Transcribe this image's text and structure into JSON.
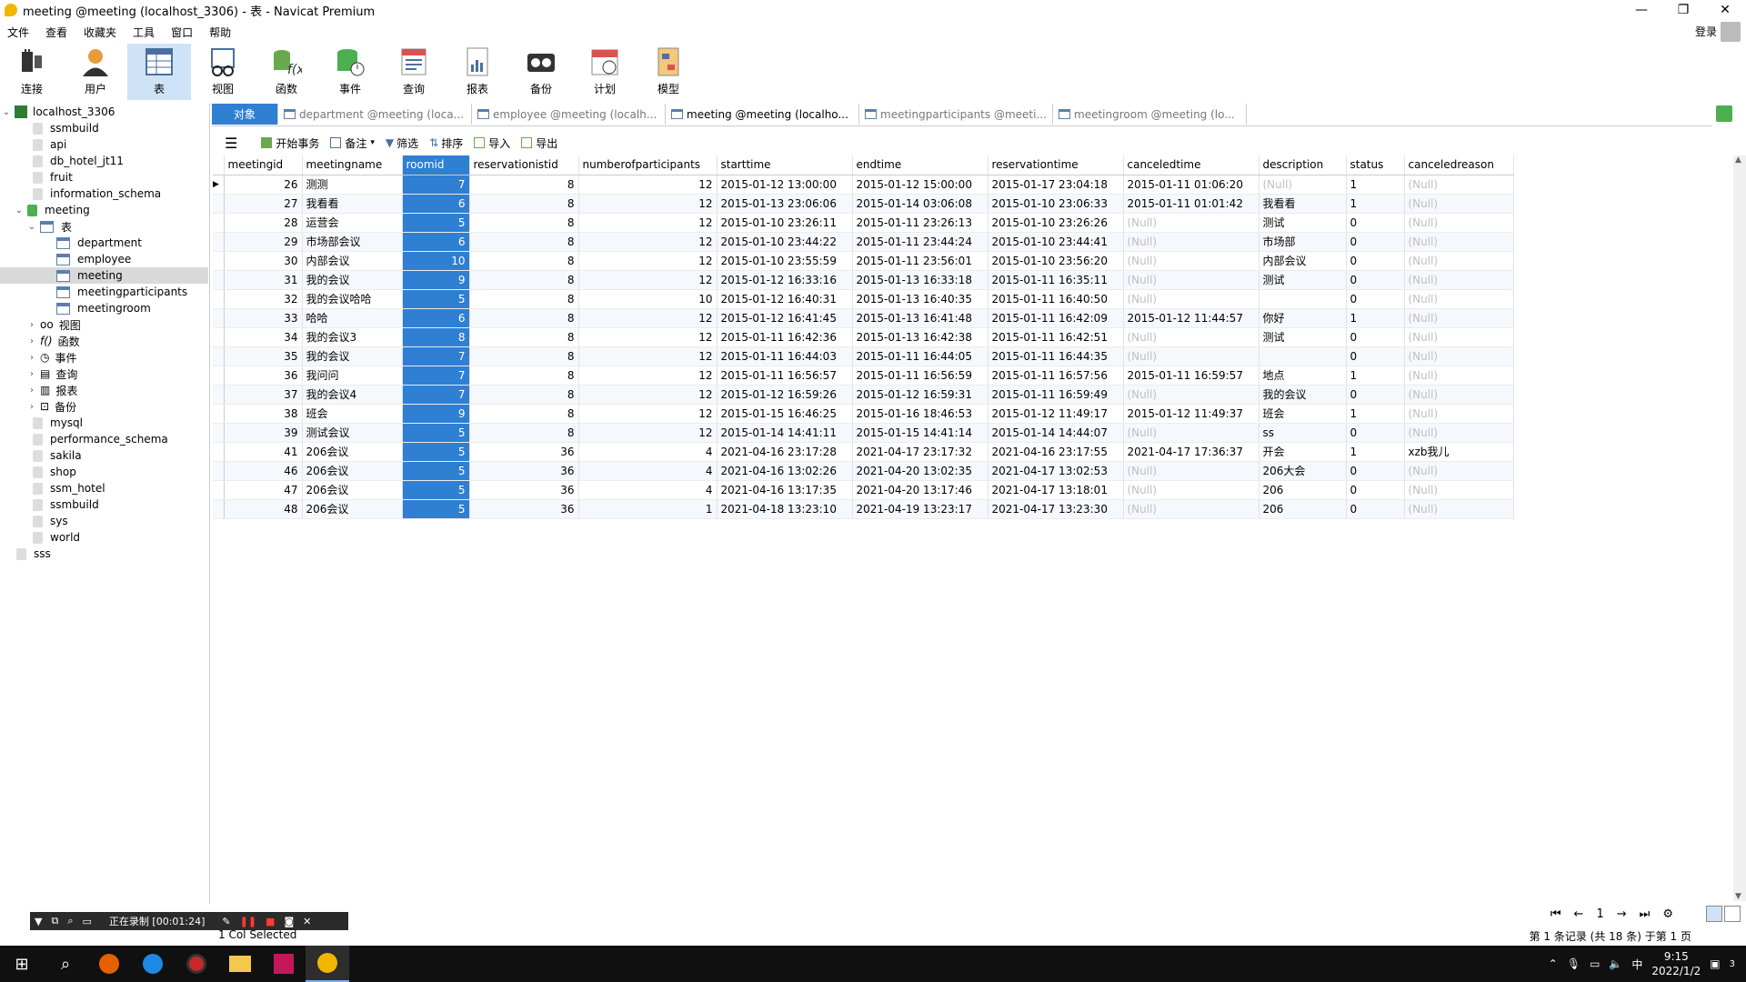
{
  "window": {
    "title": "meeting @meeting (localhost_3306) - 表 - Navicat Premium"
  },
  "menu": [
    "文件",
    "查看",
    "收藏夹",
    "工具",
    "窗口",
    "帮助"
  ],
  "login_label": "登录",
  "toolbar": [
    {
      "label": "连接"
    },
    {
      "label": "用户"
    },
    {
      "label": "表"
    },
    {
      "label": "视图"
    },
    {
      "label": "函数"
    },
    {
      "label": "事件"
    },
    {
      "label": "查询"
    },
    {
      "label": "报表"
    },
    {
      "label": "备份"
    },
    {
      "label": "计划"
    },
    {
      "label": "模型"
    }
  ],
  "sidebar": {
    "connection": "localhost_3306",
    "databases_before": [
      "ssmbuild",
      "api",
      "db_hotel_jt11",
      "fruit",
      "information_schema"
    ],
    "open_db": "meeting",
    "tables_folder": "表",
    "tables": [
      "department",
      "employee",
      "meeting",
      "meetingparticipants",
      "meetingroom"
    ],
    "other_folders": [
      "视图",
      "函数",
      "事件",
      "查询",
      "报表",
      "备份"
    ],
    "databases_after": [
      "mysql",
      "performance_schema",
      "sakila",
      "shop",
      "ssm_hotel",
      "ssmbuild",
      "sys",
      "world"
    ],
    "other_connection": "sss"
  },
  "tabs": [
    {
      "label": "对象"
    },
    {
      "label": "department @meeting (loca..."
    },
    {
      "label": "employee @meeting (localh..."
    },
    {
      "label": "meeting @meeting (localho..."
    },
    {
      "label": "meetingparticipants @meeti..."
    },
    {
      "label": "meetingroom @meeting (lo..."
    }
  ],
  "gridbar": {
    "menu_icon": "☰",
    "begin_tx": "开始事务",
    "note": "备注",
    "filter": "筛选",
    "sort": "排序",
    "import": "导入",
    "export": "导出"
  },
  "table": {
    "columns": [
      "meetingid",
      "meetingname",
      "roomid",
      "reservationistid",
      "numberofparticipants",
      "starttime",
      "endtime",
      "reservationtime",
      "canceledtime",
      "description",
      "status",
      "canceledreason"
    ],
    "rows": [
      [
        "26",
        "测测",
        "7",
        "8",
        "12",
        "2015-01-12 13:00:00",
        "2015-01-12 15:00:00",
        "2015-01-17 23:04:18",
        "2015-01-11 01:06:20",
        "(Null)",
        "1",
        "(Null)"
      ],
      [
        "27",
        "我看看",
        "6",
        "8",
        "12",
        "2015-01-13 23:06:06",
        "2015-01-14 03:06:08",
        "2015-01-10 23:06:33",
        "2015-01-11 01:01:42",
        "我看看",
        "1",
        "(Null)"
      ],
      [
        "28",
        "运营会",
        "5",
        "8",
        "12",
        "2015-01-10 23:26:11",
        "2015-01-11 23:26:13",
        "2015-01-10 23:26:26",
        "(Null)",
        "测试",
        "0",
        "(Null)"
      ],
      [
        "29",
        "市场部会议",
        "6",
        "8",
        "12",
        "2015-01-10 23:44:22",
        "2015-01-11 23:44:24",
        "2015-01-10 23:44:41",
        "(Null)",
        "市场部",
        "0",
        "(Null)"
      ],
      [
        "30",
        "内部会议",
        "10",
        "8",
        "12",
        "2015-01-10 23:55:59",
        "2015-01-11 23:56:01",
        "2015-01-10 23:56:20",
        "(Null)",
        "内部会议",
        "0",
        "(Null)"
      ],
      [
        "31",
        "我的会议",
        "9",
        "8",
        "12",
        "2015-01-12 16:33:16",
        "2015-01-13 16:33:18",
        "2015-01-11 16:35:11",
        "(Null)",
        "测试",
        "0",
        "(Null)"
      ],
      [
        "32",
        "我的会议哈哈",
        "5",
        "8",
        "10",
        "2015-01-12 16:40:31",
        "2015-01-13 16:40:35",
        "2015-01-11 16:40:50",
        "(Null)",
        "",
        "0",
        "(Null)"
      ],
      [
        "33",
        "哈哈",
        "6",
        "8",
        "12",
        "2015-01-12 16:41:45",
        "2015-01-13 16:41:48",
        "2015-01-11 16:42:09",
        "2015-01-12 11:44:57",
        "你好",
        "1",
        "(Null)"
      ],
      [
        "34",
        "我的会议3",
        "8",
        "8",
        "12",
        "2015-01-11 16:42:36",
        "2015-01-13 16:42:38",
        "2015-01-11 16:42:51",
        "(Null)",
        "测试",
        "0",
        "(Null)"
      ],
      [
        "35",
        "我的会议",
        "7",
        "8",
        "12",
        "2015-01-11 16:44:03",
        "2015-01-11 16:44:05",
        "2015-01-11 16:44:35",
        "(Null)",
        "",
        "0",
        "(Null)"
      ],
      [
        "36",
        "我问问",
        "7",
        "8",
        "12",
        "2015-01-11 16:56:57",
        "2015-01-11 16:56:59",
        "2015-01-11 16:57:56",
        "2015-01-11 16:59:57",
        "地点",
        "1",
        "(Null)"
      ],
      [
        "37",
        "我的会议4",
        "7",
        "8",
        "12",
        "2015-01-12 16:59:26",
        "2015-01-12 16:59:31",
        "2015-01-11 16:59:49",
        "(Null)",
        "我的会议",
        "0",
        "(Null)"
      ],
      [
        "38",
        "班会",
        "9",
        "8",
        "12",
        "2015-01-15 16:46:25",
        "2015-01-16 18:46:53",
        "2015-01-12 11:49:17",
        "2015-01-12 11:49:37",
        "班会",
        "1",
        "(Null)"
      ],
      [
        "39",
        "测试会议",
        "5",
        "8",
        "12",
        "2015-01-14 14:41:11",
        "2015-01-15 14:41:14",
        "2015-01-14 14:44:07",
        "(Null)",
        "ss",
        "0",
        "(Null)"
      ],
      [
        "41",
        "206会议",
        "5",
        "36",
        "4",
        "2021-04-16 23:17:28",
        "2021-04-17 23:17:32",
        "2021-04-16 23:17:55",
        "2021-04-17 17:36:37",
        "开会",
        "1",
        "xzb我儿"
      ],
      [
        "46",
        "206会议",
        "5",
        "36",
        "4",
        "2021-04-16 13:02:26",
        "2021-04-20 13:02:35",
        "2021-04-17 13:02:53",
        "(Null)",
        "206大会",
        "0",
        "(Null)"
      ],
      [
        "47",
        "206会议",
        "5",
        "36",
        "4",
        "2021-04-16 13:17:35",
        "2021-04-20 13:17:46",
        "2021-04-17 13:18:01",
        "(Null)",
        "206",
        "0",
        "(Null)"
      ],
      [
        "48",
        "206会议",
        "5",
        "36",
        "1",
        "2021-04-18 13:23:10",
        "2021-04-19 13:23:17",
        "2021-04-17 13:23:30",
        "(Null)",
        "206",
        "0",
        "(Null)"
      ]
    ]
  },
  "pager": {
    "page": "1"
  },
  "status": {
    "left": "1 Col Selected",
    "right": "第 1 条记录 (共 18 条) 于第 1 页"
  },
  "recorder": {
    "label": "正在录制 [00:01:24]"
  },
  "taskbar": {
    "ime": "中",
    "time": "9:15",
    "date": "2022/1/2",
    "notif": "3"
  }
}
